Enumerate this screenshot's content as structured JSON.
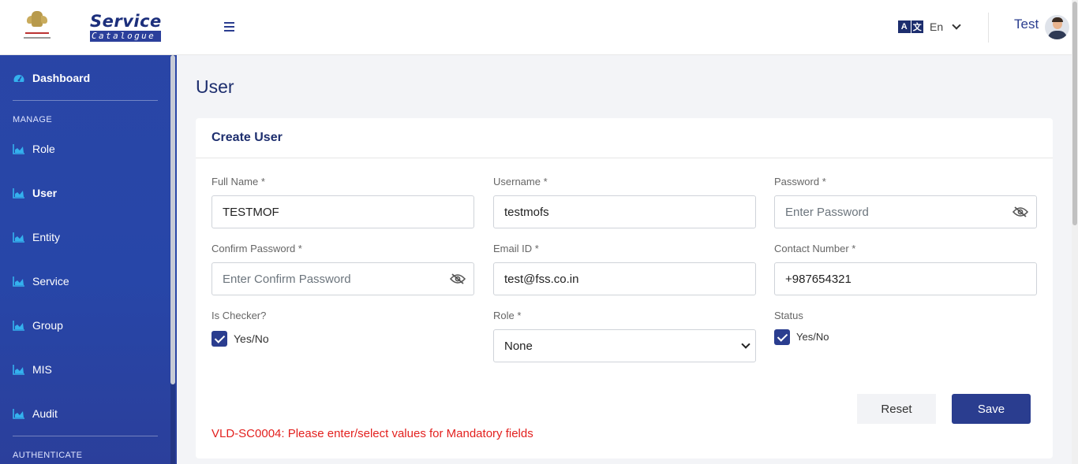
{
  "brand": {
    "title": "Service",
    "subtitle": "Catalogue"
  },
  "sidebar": {
    "dashboard": "Dashboard",
    "sections": {
      "manage": "MANAGE",
      "authenticate": "AUTHENTICATE"
    },
    "items": [
      {
        "label": "Role",
        "icon": "chart-icon"
      },
      {
        "label": "User",
        "icon": "chart-icon",
        "active": true
      },
      {
        "label": "Entity",
        "icon": "chart-icon"
      },
      {
        "label": "Service",
        "icon": "chart-icon"
      },
      {
        "label": "Group",
        "icon": "chart-icon"
      },
      {
        "label": "MIS",
        "icon": "chart-icon"
      },
      {
        "label": "Audit",
        "icon": "chart-icon"
      }
    ]
  },
  "header": {
    "language": "En",
    "user": "Test"
  },
  "page": {
    "title": "User"
  },
  "form": {
    "title": "Create User",
    "full_name": {
      "label": "Full Name *",
      "value": "TESTMOF"
    },
    "username": {
      "label": "Username *",
      "value": "testmofs"
    },
    "password": {
      "label": "Password *",
      "placeholder": "Enter Password"
    },
    "confirm_password": {
      "label": "Confirm Password *",
      "placeholder": "Enter Confirm Password"
    },
    "email": {
      "label": "Email ID *",
      "value": "test@fss.co.in"
    },
    "contact": {
      "label": "Contact Number *",
      "value": "+987654321"
    },
    "is_checker": {
      "label": "Is Checker?",
      "option": "Yes/No",
      "checked": true
    },
    "role": {
      "label": "Role *",
      "value": "None"
    },
    "status": {
      "label": "Status",
      "option": "Yes/No",
      "checked": true
    },
    "reset": "Reset",
    "save": "Save",
    "error": "VLD-SC0004: Please enter/select values for Mandatory fields"
  },
  "colors": {
    "primary": "#2a3d8f",
    "sidebar": "#2a45a6",
    "error": "#e3211f",
    "accent": "#34b1ee"
  }
}
